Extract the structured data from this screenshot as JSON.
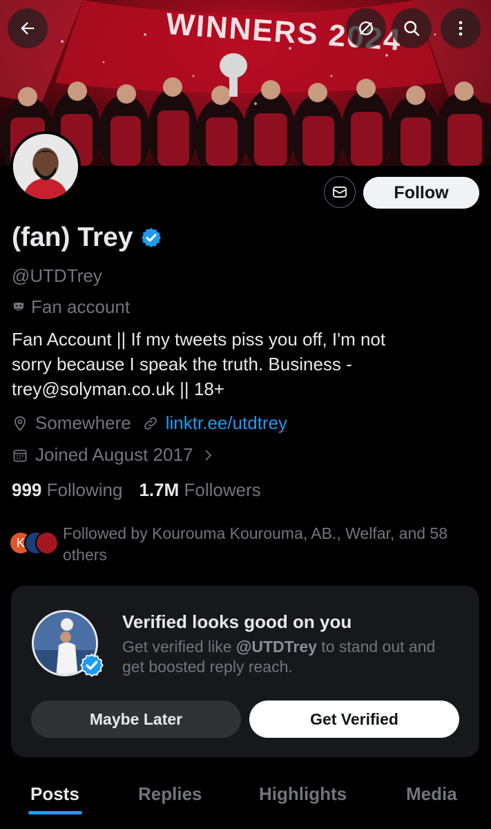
{
  "banner": {
    "text": "WINNERS 2024"
  },
  "profile": {
    "display_name": "(fan) Trey",
    "handle": "@UTDTrey",
    "label": "Fan account",
    "bio_lines": [
      "Fan Account || If my tweets piss you off, I'm not",
      "sorry because I speak the truth. Business -",
      "trey@solyman.co.uk || 18+"
    ],
    "location": "Somewhere",
    "link": "linktr.ee/utdtrey",
    "joined": "Joined August 2017",
    "following_count": "999",
    "following_label": "Following",
    "followers_count": "1.7M",
    "followers_label": "Followers",
    "followed_by_lines": [
      "Followed by Kourouma Kourouma, AB., Welfar, and 58",
      "others"
    ],
    "mini_avatar_letter": "K"
  },
  "actions": {
    "follow_label": "Follow"
  },
  "verified_card": {
    "title": "Verified looks good on you",
    "sub_line1_prefix": "Get verified like ",
    "sub_line1_handle": "@UTDTrey",
    "sub_line1_suffix": " to stand out and",
    "sub_line2": "get boosted reply reach.",
    "maybe_label": "Maybe Later",
    "get_label": "Get Verified"
  },
  "tabs": [
    {
      "label": "Posts",
      "active": true
    },
    {
      "label": "Replies",
      "active": false
    },
    {
      "label": "Highlights",
      "active": false
    },
    {
      "label": "Media",
      "active": false
    }
  ],
  "colors": {
    "accent": "#1d9bf0",
    "background": "#000000",
    "muted": "#71767b",
    "card": "#16181c"
  }
}
